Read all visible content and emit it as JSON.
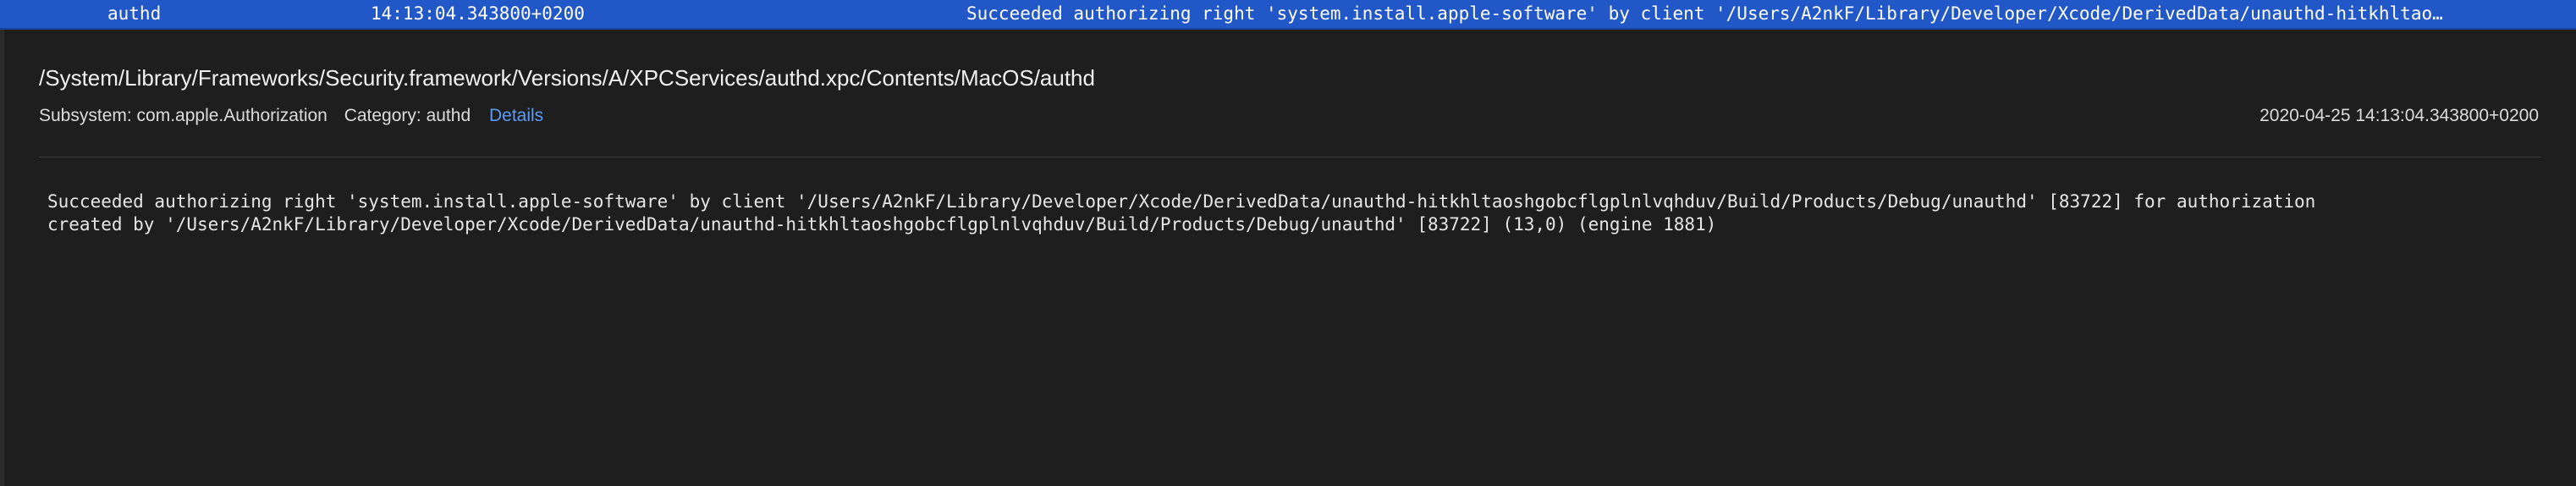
{
  "log_row": {
    "process": "authd",
    "time": "14:13:04.343800+0200",
    "message": "Succeeded authorizing right 'system.install.apple-software' by client '/Users/A2nkF/Library/Developer/Xcode/DerivedData/unauthd-hitkhltao…"
  },
  "detail": {
    "path": "/System/Library/Frameworks/Security.framework/Versions/A/XPCServices/authd.xpc/Contents/MacOS/authd",
    "subsystem": "Subsystem: com.apple.Authorization",
    "category": "Category: authd",
    "details_link": "Details",
    "timestamp": "2020-04-25 14:13:04.343800+0200",
    "message_line1": "Succeeded authorizing right 'system.install.apple-software' by client '/Users/A2nkF/Library/Developer/Xcode/DerivedData/unauthd-hitkhltaoshgobcflgplnlvqhduv/Build/Products/Debug/unauthd' [83722] for authorization",
    "message_line2": "created by '/Users/A2nkF/Library/Developer/Xcode/DerivedData/unauthd-hitkhltaoshgobcflgplnlvqhduv/Build/Products/Debug/unauthd' [83722] (13,0) (engine 1881)"
  },
  "colors": {
    "selection": "#2257c7",
    "background": "#1e1e1e",
    "link": "#5a9cf8"
  }
}
